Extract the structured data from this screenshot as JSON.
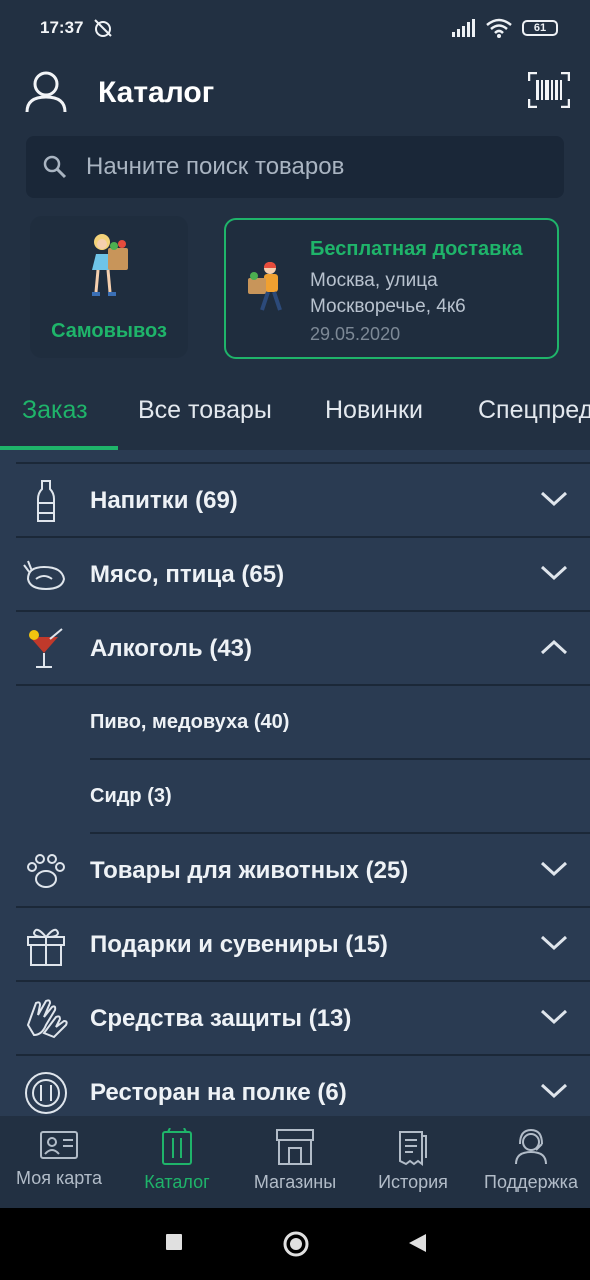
{
  "status": {
    "time": "17:37",
    "battery": "61"
  },
  "header": {
    "title": "Каталог"
  },
  "search": {
    "placeholder": "Начните поиск товаров"
  },
  "pickup": {
    "label": "Самовывоз"
  },
  "delivery": {
    "title": "Бесплатная доставка",
    "address_line1": "Москва, улица",
    "address_line2": "Москворечье, 4к6",
    "date": "29.05.2020"
  },
  "tabs": [
    {
      "label": "Заказ",
      "active": true
    },
    {
      "label": "Все товары"
    },
    {
      "label": "Новинки"
    },
    {
      "label": "Спецпредложения"
    }
  ],
  "categories": [
    {
      "label": "Напитки (69)",
      "icon": "bottle-icon",
      "expanded": false
    },
    {
      "label": "Мясо, птица (65)",
      "icon": "chicken-icon",
      "expanded": false
    },
    {
      "label": "Алкоголь (43)",
      "icon": "cocktail-icon",
      "expanded": true,
      "children": [
        {
          "label": "Пиво, медовуха  (40)"
        },
        {
          "label": "Сидр (3)"
        }
      ]
    },
    {
      "label": "Товары для животных (25)",
      "icon": "paw-icon",
      "expanded": false
    },
    {
      "label": "Подарки и сувениры (15)",
      "icon": "gift-icon",
      "expanded": false
    },
    {
      "label": "Средства защиты (13)",
      "icon": "gloves-icon",
      "expanded": false
    },
    {
      "label": "Ресторан на полке (6)",
      "icon": "plate-icon",
      "expanded": false
    }
  ],
  "bottom_nav": [
    {
      "label": "Моя карта",
      "icon": "id-card-icon"
    },
    {
      "label": "Каталог",
      "icon": "catalog-icon",
      "active": true
    },
    {
      "label": "Магазины",
      "icon": "store-icon"
    },
    {
      "label": "История",
      "icon": "receipt-icon"
    },
    {
      "label": "Поддержка",
      "icon": "support-icon"
    }
  ],
  "colors": {
    "accent": "#1fb46a",
    "background": "#2a3b52",
    "header": "#223042"
  }
}
